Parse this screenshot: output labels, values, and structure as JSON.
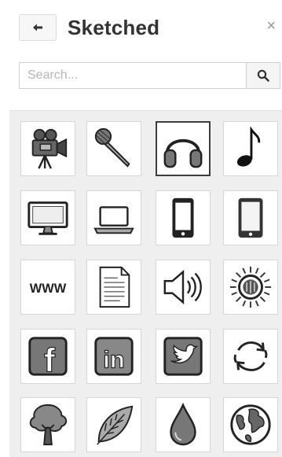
{
  "header": {
    "title": "Sketched",
    "close_glyph": "×"
  },
  "search": {
    "placeholder": "Search..."
  },
  "icons": [
    {
      "name": "movie-camera-icon"
    },
    {
      "name": "microphone-icon"
    },
    {
      "name": "headphones-icon"
    },
    {
      "name": "music-note-icon"
    },
    {
      "name": "monitor-icon"
    },
    {
      "name": "laptop-icon"
    },
    {
      "name": "smartphone-icon"
    },
    {
      "name": "tablet-icon"
    },
    {
      "name": "www-icon",
      "label": "WWW"
    },
    {
      "name": "document-icon"
    },
    {
      "name": "speaker-volume-icon"
    },
    {
      "name": "sun-badge-icon"
    },
    {
      "name": "facebook-icon",
      "label": "f"
    },
    {
      "name": "linkedin-icon",
      "label": "in"
    },
    {
      "name": "twitter-icon"
    },
    {
      "name": "refresh-icon"
    },
    {
      "name": "tree-icon"
    },
    {
      "name": "leaf-icon"
    },
    {
      "name": "water-drop-icon"
    },
    {
      "name": "globe-icon"
    }
  ],
  "selected_index": 2
}
